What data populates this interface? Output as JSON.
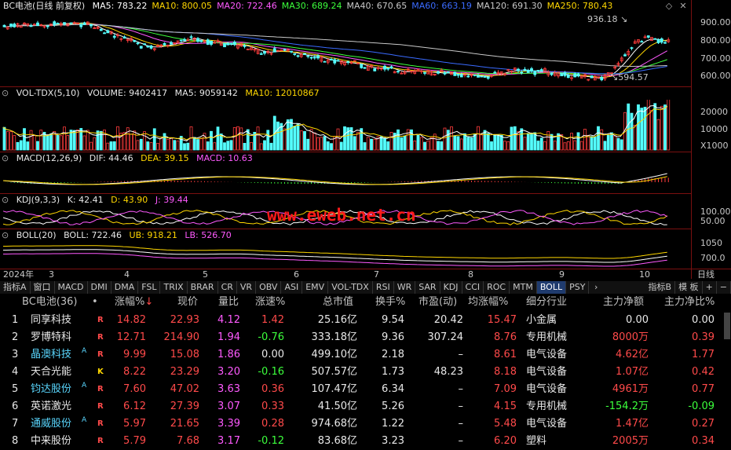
{
  "main_panel": {
    "title": "BC电池(日线 前复权)",
    "ma": [
      {
        "label": "MA5: 783.22",
        "color": "#ffffff"
      },
      {
        "label": "MA10: 800.05",
        "color": "#ffd700"
      },
      {
        "label": "MA20: 722.46",
        "color": "#ff5aff"
      },
      {
        "label": "MA30: 689.24",
        "color": "#3cff3c"
      },
      {
        "label": "MA40: 670.65",
        "color": "#c8c8c8"
      },
      {
        "label": "MA60: 663.19",
        "color": "#3a6bff"
      },
      {
        "label": "MA120: 691.30",
        "color": "#c8c8c8"
      },
      {
        "label": "MA250: 780.43",
        "color": "#ffd700"
      }
    ],
    "y_ticks": [
      "900.00",
      "800.00",
      "700.00",
      "600.00"
    ],
    "high_mark": "936.18",
    "low_mark": "594.57"
  },
  "vol_panel": {
    "header": [
      "VOL-TDX(5,10)",
      "VOLUME: 9402417",
      "MA5: 9059142",
      "MA10: 12010867"
    ],
    "y_ticks": [
      "20000",
      "10000"
    ],
    "unit": "X1000"
  },
  "macd_panel": {
    "header": [
      "MACD(12,26,9)",
      "DIF: 44.46",
      "DEA: 39.15",
      "MACD: 10.63"
    ]
  },
  "kdj_panel": {
    "header": [
      "KDJ(9,3,3)",
      "K: 42.41",
      "D: 43.90",
      "J: 39.44"
    ],
    "y_ticks": [
      "100.00",
      "50.00"
    ]
  },
  "boll_panel": {
    "header": [
      "BOLL(20)",
      "BOLL: 722.46",
      "UB: 918.21",
      "LB: 526.70"
    ],
    "y_ticks": [
      "1050",
      "700.0"
    ]
  },
  "time_axis": {
    "year": "2024年",
    "months": [
      "3",
      "4",
      "5",
      "6",
      "7",
      "8",
      "9",
      "10"
    ],
    "period": "日线"
  },
  "watermark": "www.eweb.net.cn",
  "tabs": [
    "指标A",
    "窗口",
    "MACD",
    "DMI",
    "DMA",
    "FSL",
    "TRIX",
    "BRAR",
    "CR",
    "VR",
    "OBV",
    "ASI",
    "EMV",
    "VOL-TDX",
    "RSI",
    "WR",
    "SAR",
    "KDJ",
    "CCI",
    "ROC",
    "MTM",
    "BOLL",
    "PSY"
  ],
  "tabs_right": [
    "指标B",
    "模 板",
    "+",
    "−"
  ],
  "active_tab": "BOLL",
  "table": {
    "title": "BC电池(36)",
    "dot": "•",
    "headers": [
      "涨幅%",
      "现价",
      "量比",
      "涨速%",
      "总市值",
      "换手%",
      "市盈(动)",
      "均涨幅%",
      "细分行业",
      "主力净额",
      "主力净比%"
    ],
    "sort_arrow": "↓",
    "rows": [
      {
        "no": "1",
        "name": "同享科技",
        "sup": "",
        "flag": "R",
        "chg": "14.82",
        "price": "22.93",
        "vr": "4.12",
        "speed": "1.42",
        "cap": "25.16亿",
        "turn": "9.54",
        "pe": "20.42",
        "avg": "15.47",
        "ind": "小金属",
        "net": "0.00",
        "ratio": "0.00"
      },
      {
        "no": "2",
        "name": "罗博特科",
        "sup": "",
        "flag": "R",
        "chg": "12.71",
        "price": "214.90",
        "vr": "1.94",
        "speed": "-0.76",
        "cap": "333.18亿",
        "turn": "9.36",
        "pe": "307.24",
        "avg": "8.76",
        "ind": "专用机械",
        "net": "8000万",
        "ratio": "0.39"
      },
      {
        "no": "3",
        "name": "晶澳科技",
        "sup": "A",
        "flag": "R",
        "chg": "9.99",
        "price": "15.08",
        "vr": "1.86",
        "speed": "0.00",
        "cap": "499.10亿",
        "turn": "2.18",
        "pe": "–",
        "avg": "8.61",
        "ind": "电气设备",
        "net": "4.62亿",
        "ratio": "1.77"
      },
      {
        "no": "4",
        "name": "天合光能",
        "sup": "",
        "flag": "K",
        "chg": "8.22",
        "price": "23.29",
        "vr": "3.20",
        "speed": "-0.16",
        "cap": "507.57亿",
        "turn": "1.73",
        "pe": "48.23",
        "avg": "8.18",
        "ind": "电气设备",
        "net": "1.07亿",
        "ratio": "0.42"
      },
      {
        "no": "5",
        "name": "钧达股份",
        "sup": "A",
        "flag": "R",
        "chg": "7.60",
        "price": "47.02",
        "vr": "3.63",
        "speed": "0.36",
        "cap": "107.47亿",
        "turn": "6.34",
        "pe": "–",
        "avg": "7.09",
        "ind": "电气设备",
        "net": "4961万",
        "ratio": "0.77"
      },
      {
        "no": "6",
        "name": "英诺激光",
        "sup": "",
        "flag": "R",
        "chg": "6.12",
        "price": "27.39",
        "vr": "3.07",
        "speed": "0.33",
        "cap": "41.50亿",
        "turn": "5.26",
        "pe": "–",
        "avg": "4.15",
        "ind": "专用机械",
        "net": "-154.2万",
        "ratio": "-0.09"
      },
      {
        "no": "7",
        "name": "通威股份",
        "sup": "A",
        "flag": "R",
        "chg": "5.97",
        "price": "21.65",
        "vr": "3.39",
        "speed": "0.28",
        "cap": "974.68亿",
        "turn": "1.22",
        "pe": "–",
        "avg": "5.48",
        "ind": "电气设备",
        "net": "1.47亿",
        "ratio": "0.27"
      },
      {
        "no": "8",
        "name": "中来股份",
        "sup": "",
        "flag": "R",
        "chg": "5.79",
        "price": "7.68",
        "vr": "3.17",
        "speed": "-0.12",
        "cap": "83.68亿",
        "turn": "3.23",
        "pe": "–",
        "avg": "6.20",
        "ind": "塑料",
        "net": "2005万",
        "ratio": "0.34"
      }
    ]
  }
}
